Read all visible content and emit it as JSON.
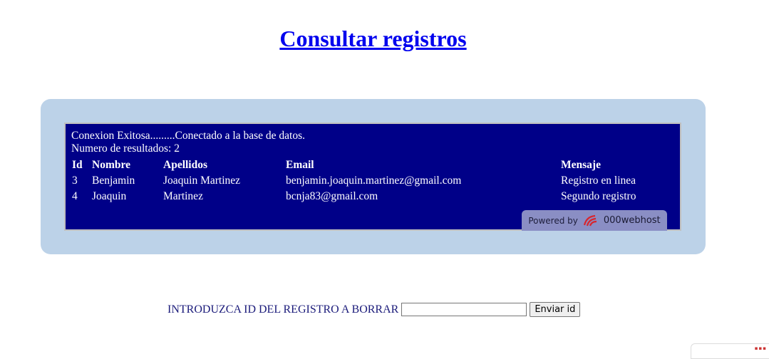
{
  "page": {
    "title": "Consultar registros"
  },
  "results": {
    "status_line": "Conexion Exitosa.........Conectado a la base de datos.",
    "count_line": "Numero de resultados: 2",
    "columns": {
      "id": "Id",
      "nombre": "Nombre",
      "apellidos": "Apellidos",
      "email": "Email",
      "mensaje": "Mensaje"
    },
    "rows": [
      {
        "id": "3",
        "nombre": "Benjamin",
        "apellidos": "Joaquin Martinez",
        "email": "benjamin.joaquin.martinez@gmail.com",
        "mensaje": "Registro en linea"
      },
      {
        "id": "4",
        "nombre": "Joaquin",
        "apellidos": "Martinez",
        "email": "bcnja83@gmail.com",
        "mensaje": "Segundo registro"
      }
    ]
  },
  "badge": {
    "powered_by": "Powered by",
    "brand": "000webhost",
    "logo_icon": "000webhost-logo-icon"
  },
  "delete_form": {
    "label": "INTRODUZCA ID DEL REGISTRO A BORRAR",
    "input_value": "",
    "input_placeholder": "",
    "submit_label": "Enviar id"
  },
  "colors": {
    "panel_background": "#bcd2e8",
    "results_background": "#000088",
    "title_link": "#0000ee",
    "form_label": "#1a1a7a"
  }
}
